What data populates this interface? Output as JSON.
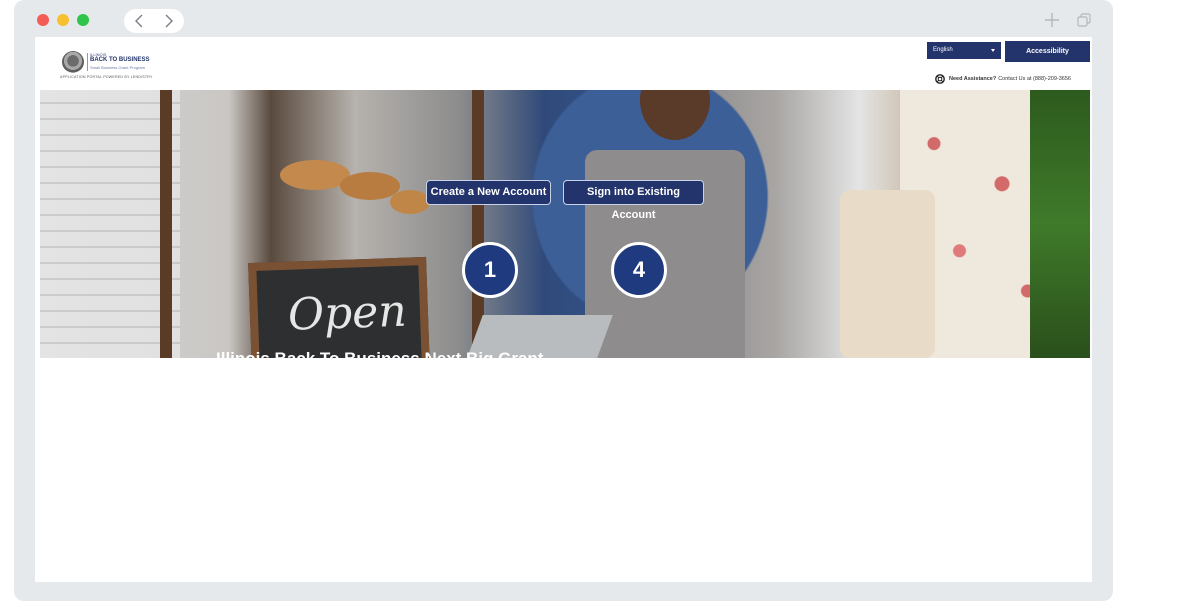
{
  "browser": {
    "back_label": "back",
    "forward_label": "forward"
  },
  "header": {
    "logo": {
      "state": "ILLINOIS",
      "name": "BACK TO BUSINESS",
      "subtitle": "Small Business Grant Program",
      "tagline": "APPLICATION PORTAL POWERED BY LENDISTRY"
    },
    "language_select": {
      "value": "English"
    },
    "accessibility_label": "Accessibility",
    "assistance": {
      "strong": "Need Assistance?",
      "text": "Contact Us at (888)-209-3656"
    }
  },
  "hero": {
    "create_account_label": "Create a New Account",
    "sign_in_label": "Sign into Existing Account",
    "markers": [
      "1",
      "4"
    ],
    "caption": "Illinois Back To Business Next Big Grant"
  },
  "colors": {
    "brand_navy": "#23336b",
    "marker_blue": "#1f3a7e",
    "chrome_bg": "#e6e9ec"
  }
}
